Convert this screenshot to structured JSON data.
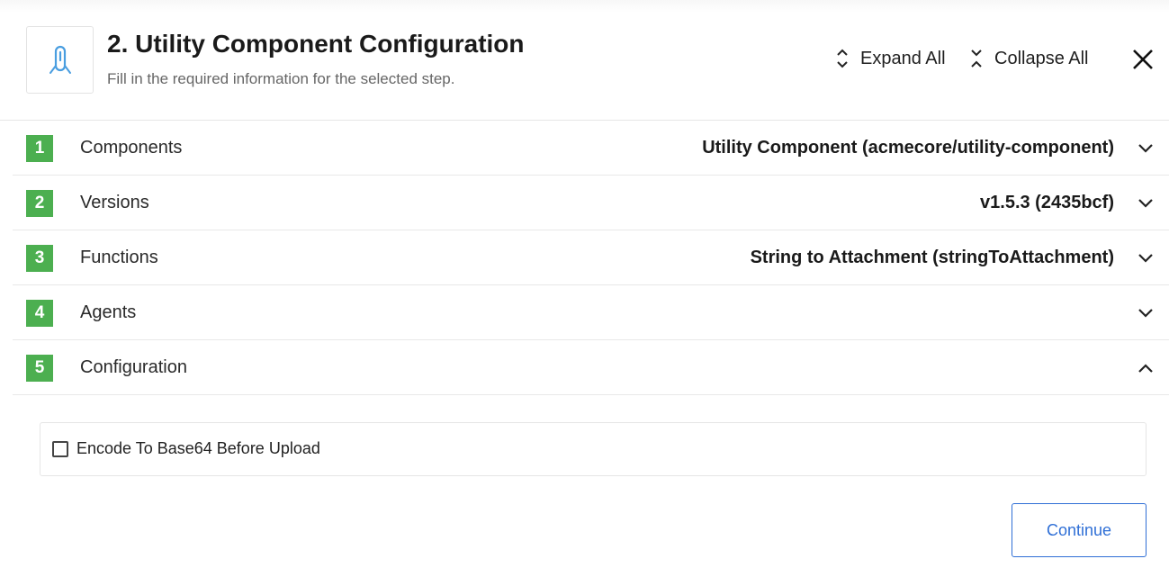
{
  "header": {
    "title": "2. Utility Component Configuration",
    "subtitle": "Fill in the required information for the selected step.",
    "expand_all_label": "Expand All",
    "collapse_all_label": "Collapse All",
    "logo_icon": "utility-component-icon",
    "close_icon": "close-icon"
  },
  "steps": [
    {
      "number": "1",
      "label": "Components",
      "value": "Utility Component (acmecore/utility-component)",
      "expanded": false
    },
    {
      "number": "2",
      "label": "Versions",
      "value": "v1.5.3 (2435bcf)",
      "expanded": false
    },
    {
      "number": "3",
      "label": "Functions",
      "value": "String to Attachment (stringToAttachment)",
      "expanded": false
    },
    {
      "number": "4",
      "label": "Agents",
      "value": "",
      "expanded": false
    },
    {
      "number": "5",
      "label": "Configuration",
      "value": "",
      "expanded": true
    }
  ],
  "configuration": {
    "encode_base64_label": "Encode To Base64 Before Upload",
    "encode_base64_checked": false
  },
  "footer": {
    "continue_label": "Continue"
  },
  "colors": {
    "step_badge": "#4caf50",
    "primary": "#2f6fd6",
    "logo_icon": "#4a9ee0"
  }
}
